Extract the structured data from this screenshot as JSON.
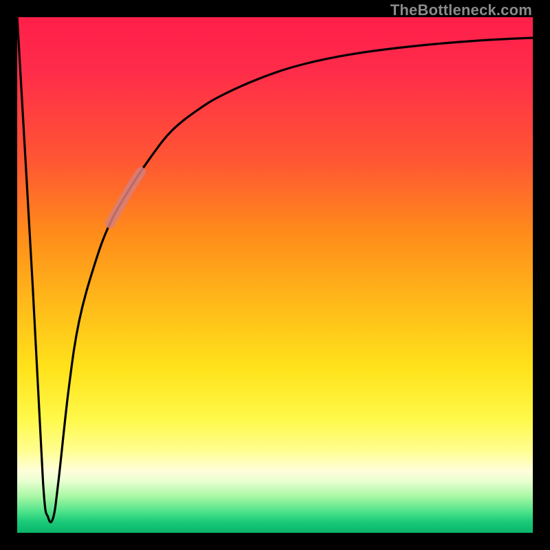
{
  "watermark": "TheBottleneck.com",
  "colors": {
    "curve": "#000000",
    "highlight": "#d77f7b",
    "frame": "#000000"
  },
  "chart_data": {
    "type": "line",
    "title": "",
    "xlabel": "",
    "ylabel": "",
    "xlim": [
      0,
      100
    ],
    "ylim": [
      0,
      100
    ],
    "grid": false,
    "legend": false,
    "series": [
      {
        "name": "bottleneck-curve",
        "x": [
          0,
          3,
          5,
          6,
          7,
          8,
          10,
          12,
          15,
          18,
          22,
          26,
          30,
          35,
          40,
          48,
          56,
          66,
          78,
          90,
          100
        ],
        "y": [
          100,
          48,
          10,
          3,
          3,
          10,
          28,
          41,
          52,
          60,
          67,
          73,
          78,
          82,
          85,
          88.5,
          91,
          93,
          94.5,
          95.5,
          96
        ]
      }
    ],
    "highlight_segment": {
      "x_range": [
        18,
        24
      ],
      "y_range": [
        60,
        70
      ]
    }
  }
}
